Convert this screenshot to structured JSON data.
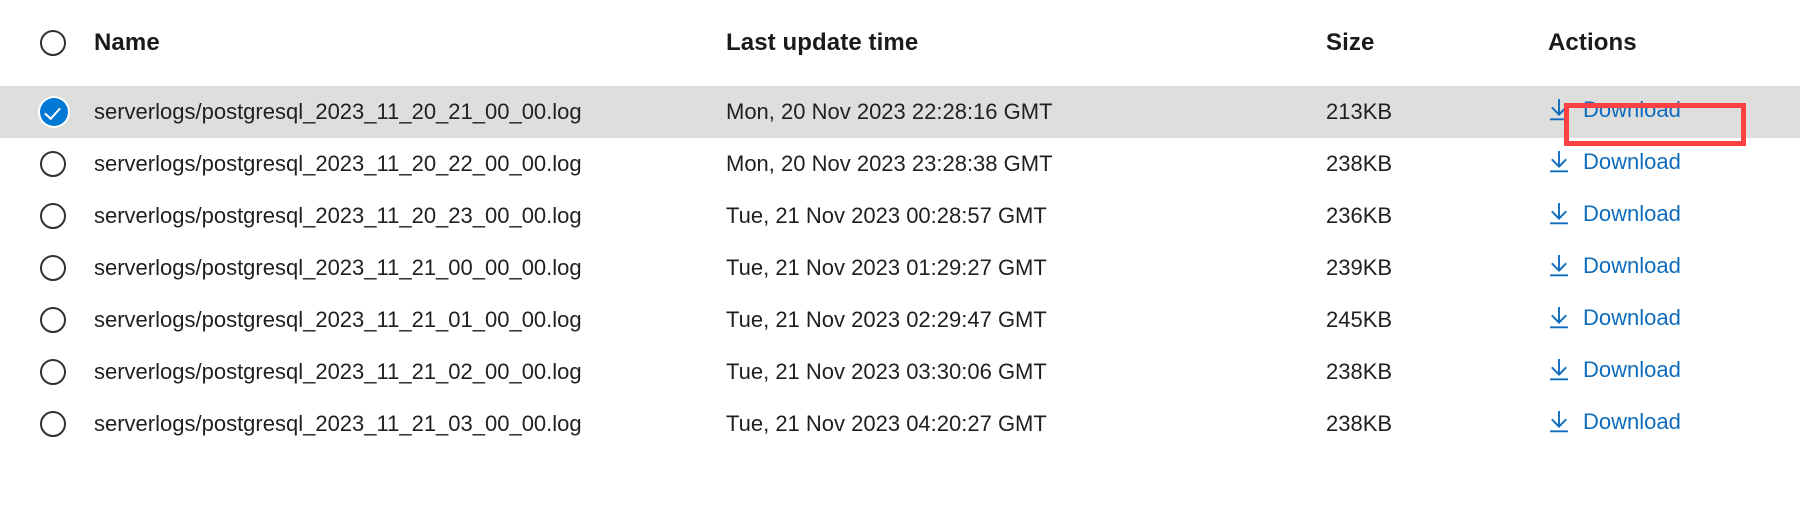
{
  "table": {
    "columns": {
      "select": "",
      "name": "Name",
      "time": "Last update time",
      "size": "Size",
      "actions": "Actions"
    },
    "action_label": "Download",
    "icons": {
      "download": "download-icon",
      "selected": "check-circle-icon",
      "unselected": "circle-outline-icon"
    },
    "rows": [
      {
        "selected": true,
        "name": "serverlogs/postgresql_2023_11_20_21_00_00.log",
        "time": "Mon, 20 Nov 2023 22:28:16 GMT",
        "size": "213KB",
        "action": "Download"
      },
      {
        "selected": false,
        "name": "serverlogs/postgresql_2023_11_20_22_00_00.log",
        "time": "Mon, 20 Nov 2023 23:28:38 GMT",
        "size": "238KB",
        "action": "Download"
      },
      {
        "selected": false,
        "name": "serverlogs/postgresql_2023_11_20_23_00_00.log",
        "time": "Tue, 21 Nov 2023 00:28:57 GMT",
        "size": "236KB",
        "action": "Download"
      },
      {
        "selected": false,
        "name": "serverlogs/postgresql_2023_11_21_00_00_00.log",
        "time": "Tue, 21 Nov 2023 01:29:27 GMT",
        "size": "239KB",
        "action": "Download"
      },
      {
        "selected": false,
        "name": "serverlogs/postgresql_2023_11_21_01_00_00.log",
        "time": "Tue, 21 Nov 2023 02:29:47 GMT",
        "size": "245KB",
        "action": "Download"
      },
      {
        "selected": false,
        "name": "serverlogs/postgresql_2023_11_21_02_00_00.log",
        "time": "Tue, 21 Nov 2023 03:30:06 GMT",
        "size": "238KB",
        "action": "Download"
      },
      {
        "selected": false,
        "name": "serverlogs/postgresql_2023_11_21_03_00_00.log",
        "time": "Tue, 21 Nov 2023 04:20:27 GMT",
        "size": "238KB",
        "action": "Download"
      }
    ]
  },
  "colors": {
    "link": "#0f6cbd",
    "selection_accent": "#0078d4",
    "selected_row_bg": "#dededd",
    "annotation": "#fb4141",
    "text": "#201f1e"
  },
  "annotation": {
    "target": "download-link-row-1",
    "shape": "rectangle"
  }
}
